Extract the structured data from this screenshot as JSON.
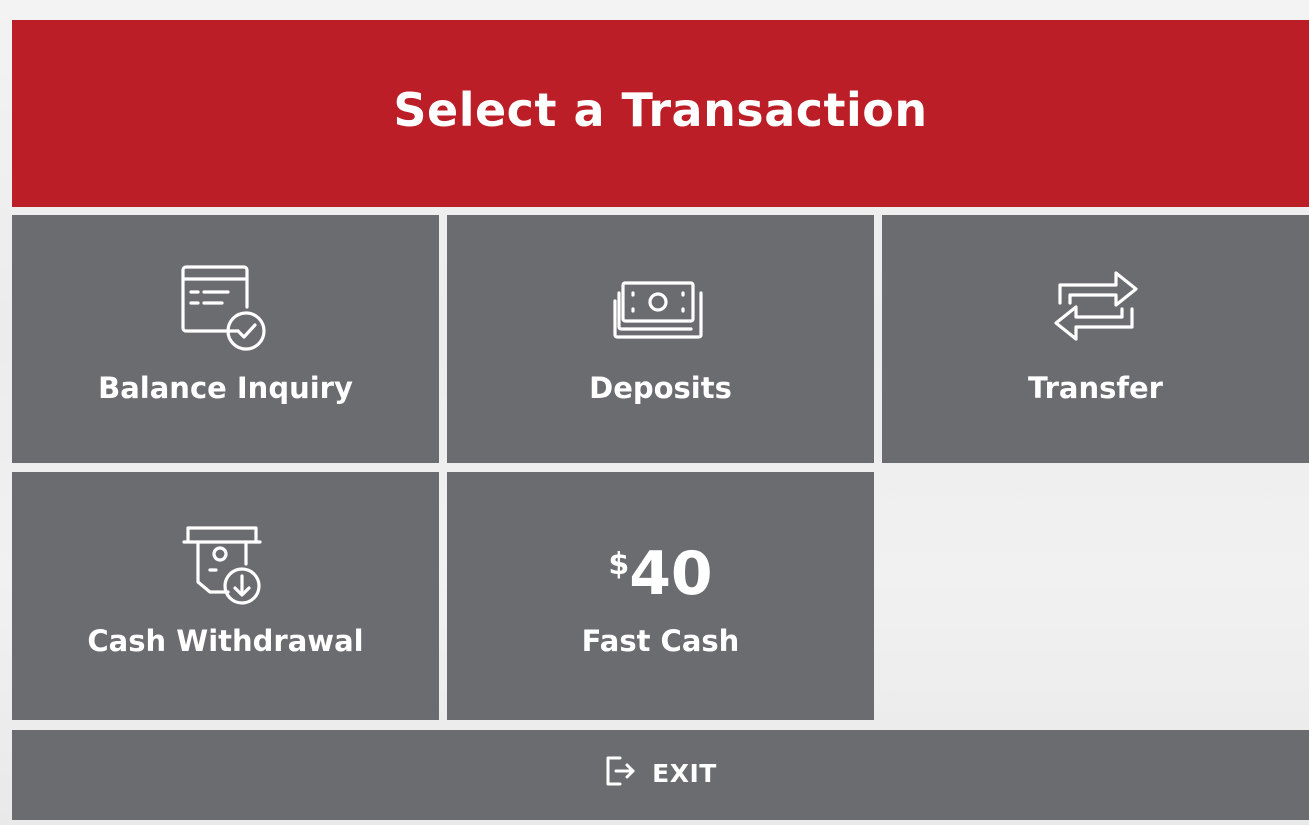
{
  "header": {
    "title": "Select a Transaction"
  },
  "tiles": [
    {
      "id": "balance",
      "label": "Balance Inquiry",
      "icon": "statement-check-icon"
    },
    {
      "id": "deposits",
      "label": "Deposits",
      "icon": "cash-stack-icon"
    },
    {
      "id": "transfer",
      "label": "Transfer",
      "icon": "transfer-arrows-icon"
    },
    {
      "id": "withdraw",
      "label": "Cash Withdrawal",
      "icon": "atm-withdraw-icon"
    },
    {
      "id": "fastcash",
      "label": "Fast Cash",
      "amount_symbol": "$",
      "amount_value": "40"
    }
  ],
  "exit": {
    "label": "EXIT",
    "icon": "exit-door-icon"
  },
  "colors": {
    "header_bg": "#bb1e26",
    "tile_bg": "#6b6c70",
    "text": "#ffffff",
    "background": "#efefef"
  }
}
